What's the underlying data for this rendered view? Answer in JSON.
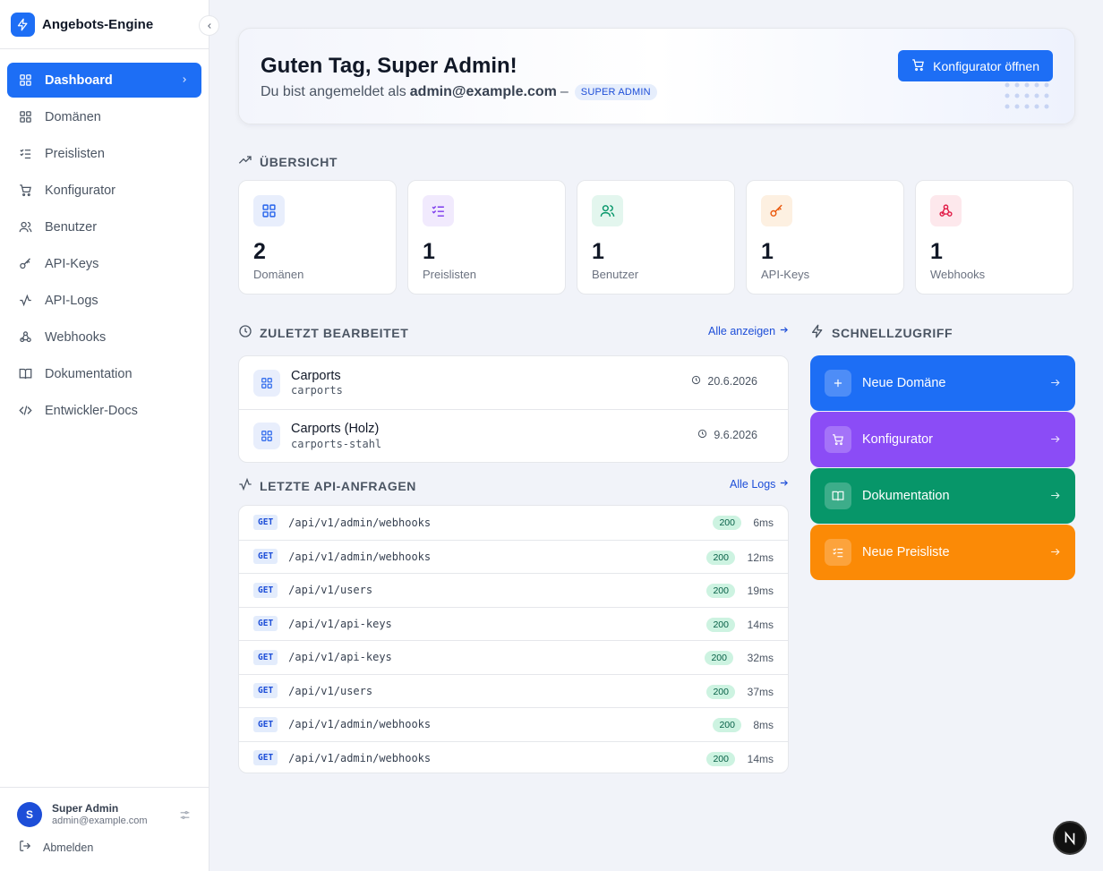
{
  "app": {
    "name": "Angebots-Engine"
  },
  "sidebar": {
    "items": [
      {
        "label": "Dashboard",
        "icon": "dashboard-icon",
        "active": true
      },
      {
        "label": "Domänen",
        "icon": "grid-icon"
      },
      {
        "label": "Preislisten",
        "icon": "list-check-icon"
      },
      {
        "label": "Konfigurator",
        "icon": "cart-icon"
      },
      {
        "label": "Benutzer",
        "icon": "users-icon"
      },
      {
        "label": "API-Keys",
        "icon": "key-icon"
      },
      {
        "label": "API-Logs",
        "icon": "activity-icon"
      },
      {
        "label": "Webhooks",
        "icon": "webhook-icon"
      },
      {
        "label": "Dokumentation",
        "icon": "book-icon"
      },
      {
        "label": "Entwickler-Docs",
        "icon": "code-icon"
      }
    ],
    "user": {
      "initial": "S",
      "name": "Super Admin",
      "email": "admin@example.com"
    },
    "logout_label": "Abmelden"
  },
  "hero": {
    "greeting": "Guten Tag, Super Admin!",
    "logged_in_prefix": "Du bist angemeldet als",
    "email": "admin@example.com",
    "separator": "–",
    "role": "SUPER ADMIN",
    "open_button": "Konfigurator öffnen"
  },
  "overview": {
    "title": "ÜBERSICHT",
    "stats": [
      {
        "value": "2",
        "label": "Domänen",
        "icon": "grid-icon",
        "color": "#2563eb",
        "bg": "#e8eefc"
      },
      {
        "value": "1",
        "label": "Preislisten",
        "icon": "list-check-icon",
        "color": "#7c3aed",
        "bg": "#f1eafd"
      },
      {
        "value": "1",
        "label": "Benutzer",
        "icon": "users-icon",
        "color": "#059669",
        "bg": "#e3f6ee"
      },
      {
        "value": "1",
        "label": "API-Keys",
        "icon": "key-icon",
        "color": "#ea580c",
        "bg": "#fdf0e1"
      },
      {
        "value": "1",
        "label": "Webhooks",
        "icon": "webhook-icon",
        "color": "#e11d48",
        "bg": "#fde8ec"
      }
    ]
  },
  "recent": {
    "title": "ZULETZT BEARBEITET",
    "link": "Alle anzeigen",
    "items": [
      {
        "name": "Carports",
        "slug": "carports",
        "date": "20.6.2026"
      },
      {
        "name": "Carports (Holz)",
        "slug": "carports-stahl",
        "date": "9.6.2026"
      }
    ]
  },
  "api_logs": {
    "title": "LETZTE API-ANFRAGEN",
    "link": "Alle Logs",
    "rows": [
      {
        "method": "GET",
        "path": "/api/v1/admin/webhooks",
        "status": "200",
        "duration": "6ms"
      },
      {
        "method": "GET",
        "path": "/api/v1/admin/webhooks",
        "status": "200",
        "duration": "12ms"
      },
      {
        "method": "GET",
        "path": "/api/v1/users",
        "status": "200",
        "duration": "19ms"
      },
      {
        "method": "GET",
        "path": "/api/v1/api-keys",
        "status": "200",
        "duration": "14ms"
      },
      {
        "method": "GET",
        "path": "/api/v1/api-keys",
        "status": "200",
        "duration": "32ms"
      },
      {
        "method": "GET",
        "path": "/api/v1/users",
        "status": "200",
        "duration": "37ms"
      },
      {
        "method": "GET",
        "path": "/api/v1/admin/webhooks",
        "status": "200",
        "duration": "8ms"
      },
      {
        "method": "GET",
        "path": "/api/v1/admin/webhooks",
        "status": "200",
        "duration": "14ms"
      }
    ]
  },
  "quick_access": {
    "title": "SCHNELLZUGRIFF",
    "items": [
      {
        "label": "Neue Domäne",
        "icon": "plus-icon",
        "color": "#1d6ef5"
      },
      {
        "label": "Konfigurator",
        "icon": "cart-icon",
        "color": "#8b4cf6"
      },
      {
        "label": "Dokumentation",
        "icon": "book-icon",
        "color": "#079669"
      },
      {
        "label": "Neue Preisliste",
        "icon": "list-check-icon",
        "color": "#fb8a06"
      }
    ]
  },
  "colors": {
    "accent": "#1d6ef5",
    "success_badge": "#cdf3e1",
    "method_badge": "#e3ecfc"
  }
}
